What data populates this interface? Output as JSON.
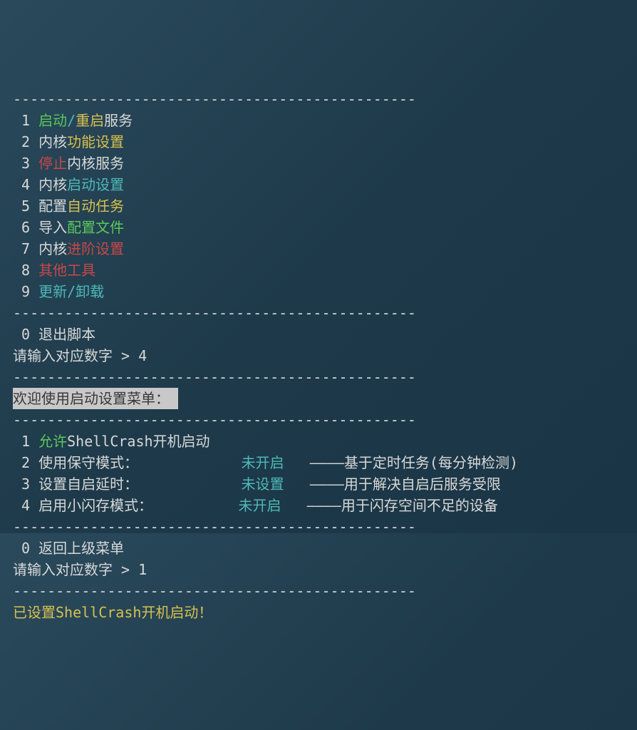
{
  "divider": "-----------------------------------------------",
  "menu1": [
    {
      "n": "1",
      "segs": [
        {
          "c": "green",
          "t": "启动"
        },
        {
          "c": "cyan",
          "t": "/"
        },
        {
          "c": "yellow",
          "t": "重启"
        },
        {
          "c": "",
          "t": "服务"
        }
      ]
    },
    {
      "n": "2",
      "segs": [
        {
          "c": "",
          "t": "内核"
        },
        {
          "c": "yellow",
          "t": "功能设置"
        }
      ]
    },
    {
      "n": "3",
      "segs": [
        {
          "c": "red",
          "t": "停止"
        },
        {
          "c": "",
          "t": "内核服务"
        }
      ]
    },
    {
      "n": "4",
      "segs": [
        {
          "c": "",
          "t": "内核"
        },
        {
          "c": "cyan",
          "t": "启动设置"
        }
      ]
    },
    {
      "n": "5",
      "segs": [
        {
          "c": "",
          "t": "配置"
        },
        {
          "c": "yellow",
          "t": "自动任务"
        }
      ]
    },
    {
      "n": "6",
      "segs": [
        {
          "c": "",
          "t": "导入"
        },
        {
          "c": "green",
          "t": "配置文件"
        }
      ]
    },
    {
      "n": "7",
      "segs": [
        {
          "c": "",
          "t": "内核"
        },
        {
          "c": "red",
          "t": "进阶设置"
        }
      ]
    },
    {
      "n": "8",
      "segs": [
        {
          "c": "red",
          "t": "其他工具"
        }
      ]
    },
    {
      "n": "9",
      "segs": [
        {
          "c": "cyan",
          "t": "更新/卸载"
        }
      ]
    }
  ],
  "exit1": {
    "n": "0",
    "label": "退出脚本"
  },
  "prompt1": {
    "label": "请输入对应数字 >",
    "value": "4"
  },
  "banner": "欢迎使用启动设置菜单：",
  "menu2": [
    {
      "n": "1",
      "pre": "",
      "col": "green",
      "lbl": "允许",
      "post": "ShellCrash开机启动",
      "status": "",
      "desc": ""
    },
    {
      "n": "2",
      "pre": "使用保守模式：",
      "col": "",
      "lbl": "",
      "post": "",
      "status": "未开启",
      "desc": "————基于定时任务(每分钟检测)"
    },
    {
      "n": "3",
      "pre": "设置自启延时：",
      "col": "",
      "lbl": "",
      "post": "",
      "status": "未设置",
      "desc": "————用于解决自启后服务受限"
    },
    {
      "n": "4",
      "pre": "启用小闪存模式：",
      "col": "",
      "lbl": "",
      "post": "",
      "status": "未开启",
      "desc": "————用于闪存空间不足的设备"
    }
  ],
  "exit2": {
    "n": "0",
    "label": "返回上级菜单"
  },
  "prompt2": {
    "label": "请输入对应数字 >",
    "value": "1"
  },
  "confirm": "已设置ShellCrash开机启动！"
}
